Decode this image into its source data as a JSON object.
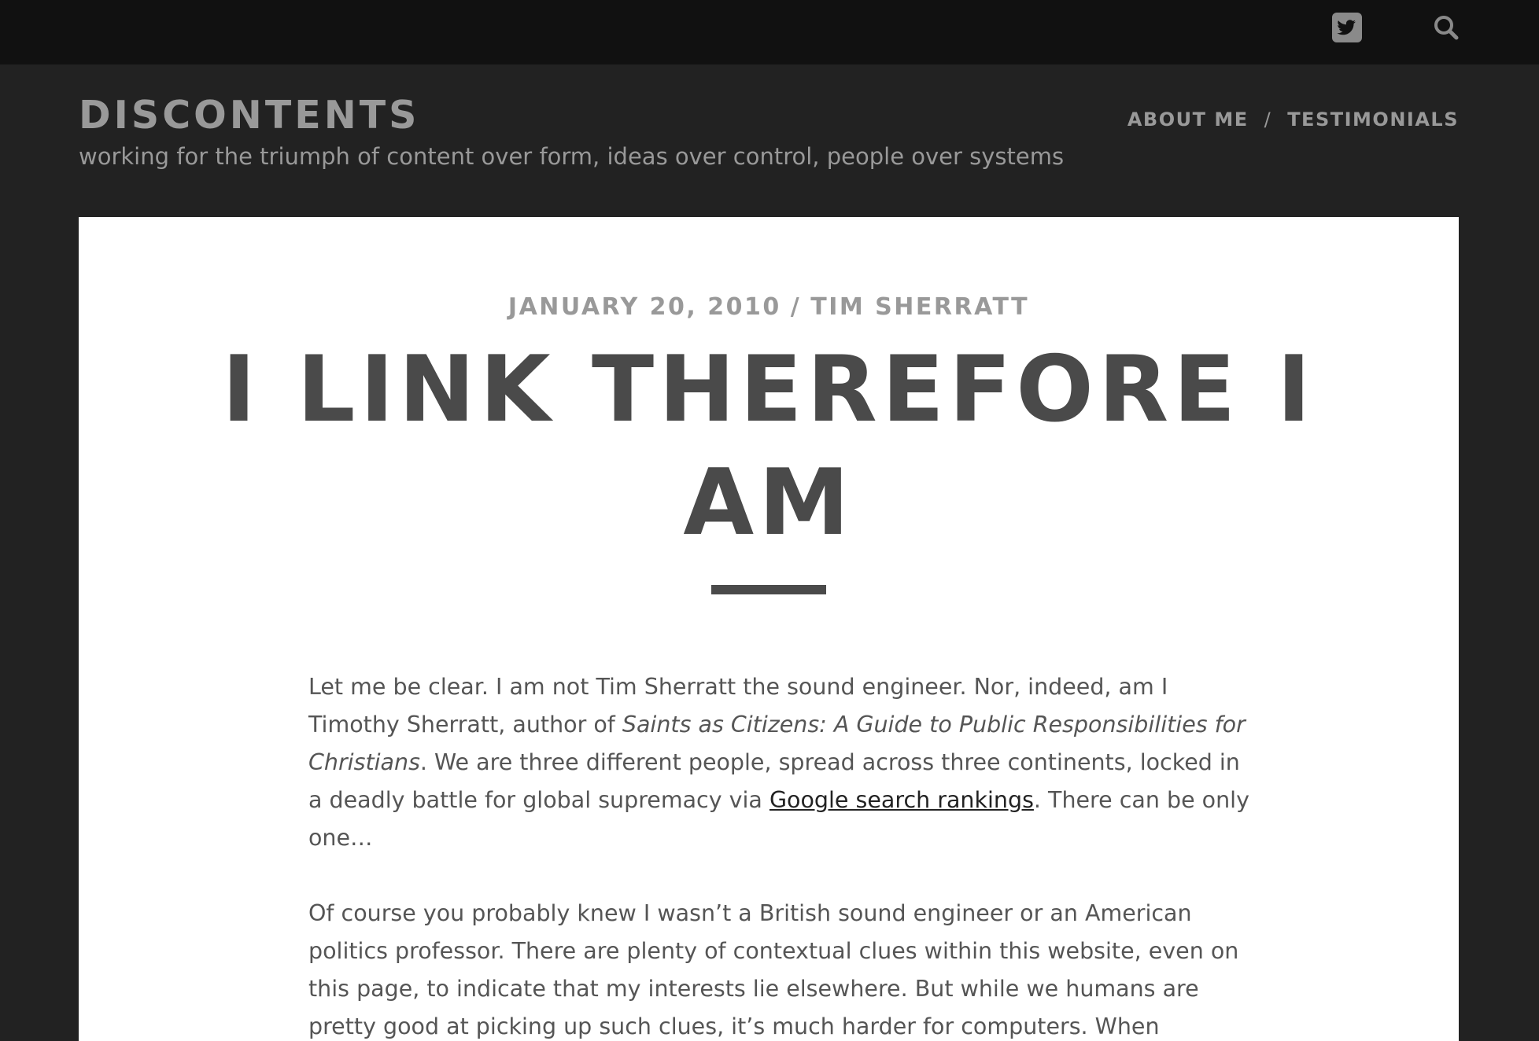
{
  "topbar": {
    "twitter_icon": "twitter-icon",
    "search_icon": "search-icon"
  },
  "header": {
    "site_title": "DISCONTENTS",
    "tagline": "working for the triumph of content over form, ideas over control, people over systems",
    "nav": {
      "about_label": "ABOUT ME",
      "separator": "/",
      "testimonials_label": "TESTIMONIALS"
    }
  },
  "post": {
    "date": "JANUARY 20, 2010",
    "meta_separator": "/",
    "author": "TIM SHERRATT",
    "title": "I LINK THEREFORE I AM",
    "paragraph1": {
      "text_before_book": "Let me be clear. I am not Tim Sherratt the sound engineer. Nor, indeed, am I Timothy Sherratt, author of ",
      "book_title": "Saints as Citizens: A Guide to Public Responsibilities for Christians",
      "text_after_book": ". We are three different people, spread across three continents, locked in a deadly battle for global supremacy via ",
      "link_text": "Google search rankings",
      "text_after_link": ". There can be only one…"
    },
    "paragraph2": {
      "text": "Of course you probably knew I wasn’t a British sound engineer or an American politics professor. There are plenty of contextual clues within this website, even on this page, to indicate that my interests lie elsewhere. But while we humans are pretty good at picking up such clues, it’s much harder for computers. When"
    }
  },
  "colors": {
    "topbar_bg": "#111111",
    "header_bg": "#222222",
    "card_bg": "#ffffff",
    "title_color": "#4a4a4a",
    "muted_text": "#999999"
  }
}
